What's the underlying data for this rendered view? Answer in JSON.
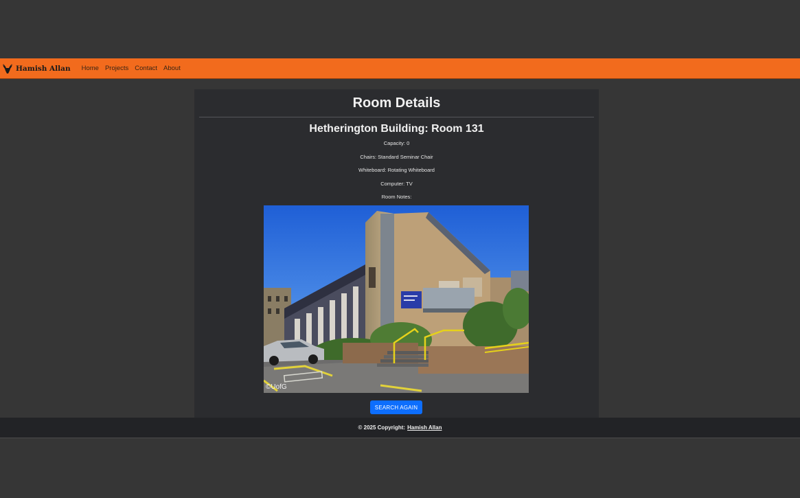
{
  "navbar": {
    "brand": "Hamish Allan",
    "logo_icon": "stag-head-icon",
    "links": [
      "Home",
      "Projects",
      "Contact",
      "About"
    ]
  },
  "card": {
    "title": "Room Details",
    "room_heading": "Hetherington Building: Room 131",
    "details": [
      "Capacity: 0",
      "Chairs: Standard Seminar Chair",
      "Whiteboard: Rotating Whiteboard",
      "Computer: TV",
      "Room Notes:"
    ],
    "image_credit": "©UofG",
    "search_button": "SEARCH AGAIN"
  },
  "footer": {
    "prefix": "© 2025 Copyright:",
    "link": "Hamish Allan"
  },
  "colors": {
    "background": "#363636",
    "navbar": "#f26b1d",
    "card": "#2b2c2f",
    "button": "#0d6efd",
    "footer": "#222326"
  }
}
